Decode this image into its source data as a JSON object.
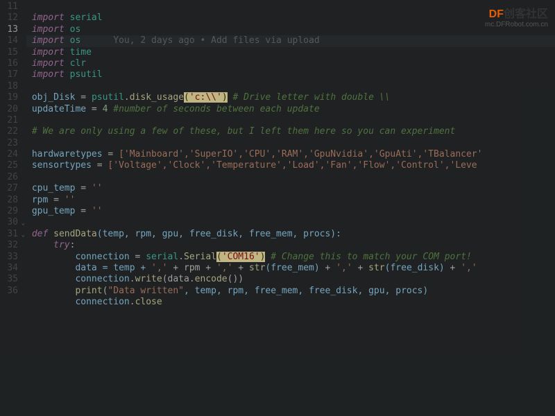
{
  "watermark": {
    "brand": "DF",
    "cn": "创客社区",
    "url": "mc.DFRobot.com.cn"
  },
  "codelens": "You, 2 days ago • Add files via upload",
  "lines": {
    "start": 11,
    "count": 26,
    "current": 13
  },
  "code": {
    "l11": {
      "kw": "import",
      "mod": "serial"
    },
    "l12": {
      "kw": "import",
      "mod": "os"
    },
    "l13": {
      "kw": "import",
      "mod": "os"
    },
    "l14": {
      "kw": "import",
      "mod": "time"
    },
    "l15": {
      "kw": "import",
      "mod": "clr"
    },
    "l16": {
      "kw": "import",
      "mod": "psutil"
    },
    "l18": {
      "lhs": "obj_Disk",
      "eq": " = ",
      "obj": "psutil",
      "dot": ".",
      "fn": "disk_usage",
      "arg": "'c:\\\\'",
      "comment": " # Drive letter with double \\\\"
    },
    "l19": {
      "lhs": "updateTime",
      "eq": " = ",
      "val": "4",
      "comment": " #number of seconds between each update"
    },
    "l21": {
      "comment": "# We are only using a few of these, but I left them here so you can experiment"
    },
    "l23": {
      "lhs": "hardwaretypes",
      "list": "['Mainboard','SuperIO','CPU','RAM','GpuNvidia','GpuAti','TBalancer'"
    },
    "l24": {
      "lhs": "sensortypes",
      "list": "['Voltage','Clock','Temperature','Load','Fan','Flow','Control','Leve"
    },
    "l26": {
      "lhs": "cpu_temp",
      "val": "''"
    },
    "l27": {
      "lhs": "rpm",
      "val": "''"
    },
    "l28": {
      "lhs": "gpu_temp",
      "val": "''"
    },
    "l30": {
      "kw": "def",
      "fn": "sendData",
      "params": "(temp, rpm, gpu, free_disk, free_mem, procs):"
    },
    "l31": {
      "kw": "try",
      "colon": ":"
    },
    "l32": {
      "lhs": "connection",
      "obj": "serial",
      "fn": "Serial",
      "arg": "'COM16'",
      "comment": " # Change this to match your COM port!"
    },
    "l33": {
      "text_a": "data = temp + ",
      "s1": "','",
      "p1": " + rpm + ",
      "s2": "','",
      "p2": " + ",
      "fn1": "str",
      "a1": "(free_mem)",
      "p3": " + ",
      "s3": "','",
      "p4": " + ",
      "fn2": "str",
      "a2": "(free_disk)",
      "p5": " + ",
      "s4": "','"
    },
    "l34": {
      "obj": "connection",
      "fn": "write",
      "args_a": "(data.",
      "fn2": "encode",
      "args_b": "())"
    },
    "l35": {
      "fn": "print",
      "s1": "\"Data written\"",
      "rest": ", temp, rpm, free_mem, free_disk, gpu, procs)"
    },
    "l36": {
      "obj": "connection",
      "fn": "close"
    }
  }
}
